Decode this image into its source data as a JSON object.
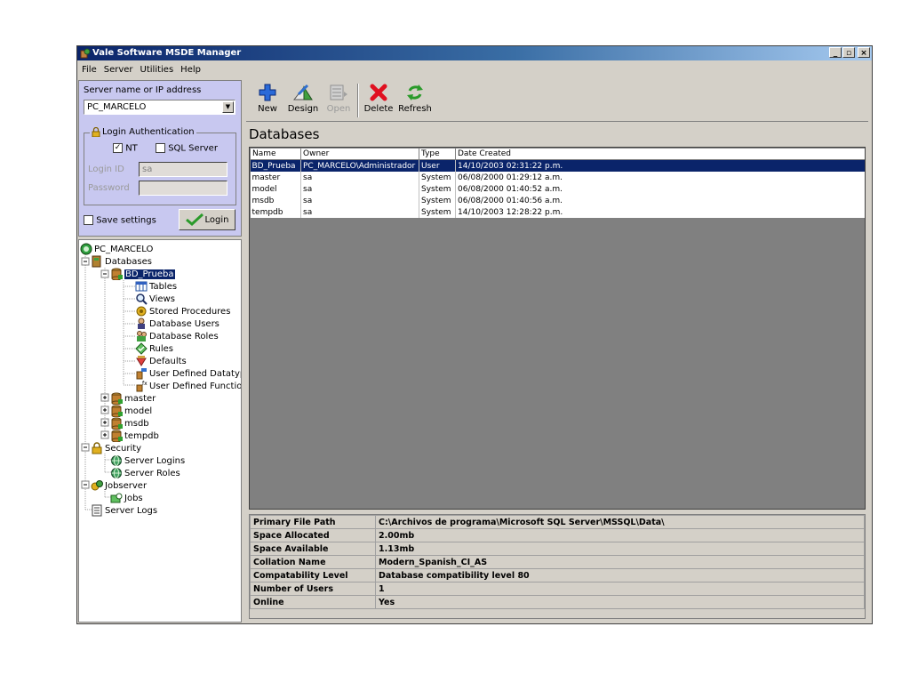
{
  "window": {
    "title": "Vale Software MSDE Manager",
    "buttons": [
      "_",
      "▫",
      "×"
    ]
  },
  "menu": [
    "File",
    "Server",
    "Utilities",
    "Help"
  ],
  "server_panel": {
    "server_label": "Server name or IP address",
    "server_value": "PC_MARCELO",
    "auth_group_label": "Login Authentication",
    "nt_label": "NT",
    "nt_checked": true,
    "sql_label": "SQL Server",
    "sql_checked": false,
    "login_id_label": "Login ID",
    "login_id_value": "sa",
    "password_label": "Password",
    "password_value": "",
    "save_settings_label": "Save settings",
    "login_button": "Login"
  },
  "tree": [
    {
      "label": "PC_MARCELO",
      "icon": "server-icon"
    },
    {
      "label": "Databases",
      "icon": "databases-icon"
    },
    {
      "label": "BD_Prueba",
      "icon": "database-icon",
      "selected": true
    },
    {
      "label": "Tables",
      "icon": "table-icon"
    },
    {
      "label": "Views",
      "icon": "view-icon"
    },
    {
      "label": "Stored Procedures",
      "icon": "stored-procedure-icon"
    },
    {
      "label": "Database Users",
      "icon": "user-icon"
    },
    {
      "label": "Database Roles",
      "icon": "roles-icon"
    },
    {
      "label": "Rules",
      "icon": "rules-icon"
    },
    {
      "label": "Defaults",
      "icon": "defaults-icon"
    },
    {
      "label": "User Defined Datatypes",
      "icon": "datatype-icon"
    },
    {
      "label": "User Defined Functions",
      "icon": "function-icon"
    },
    {
      "label": "master",
      "icon": "database-icon"
    },
    {
      "label": "model",
      "icon": "database-icon"
    },
    {
      "label": "msdb",
      "icon": "database-icon"
    },
    {
      "label": "tempdb",
      "icon": "database-icon"
    },
    {
      "label": "Security",
      "icon": "lock-icon"
    },
    {
      "label": "Server Logins",
      "icon": "globe-icon"
    },
    {
      "label": "Server Roles",
      "icon": "globe-icon"
    },
    {
      "label": "Jobserver",
      "icon": "jobserver-icon"
    },
    {
      "label": "Jobs",
      "icon": "jobs-icon"
    },
    {
      "label": "Server Logs",
      "icon": "log-icon"
    }
  ],
  "toolbar": {
    "new": "New",
    "design": "Design",
    "open": "Open",
    "delete": "Delete",
    "refresh": "Refresh"
  },
  "databases": {
    "heading": "Databases",
    "columns": [
      "Name",
      "Owner",
      "Type",
      "Date Created"
    ],
    "rows": [
      {
        "name": "BD_Prueba",
        "owner": "PC_MARCELO\\Administrador",
        "type": "User",
        "date": "14/10/2003 02:31:22 p.m.",
        "selected": true
      },
      {
        "name": "master",
        "owner": "sa",
        "type": "System",
        "date": "06/08/2000 01:29:12 a.m."
      },
      {
        "name": "model",
        "owner": "sa",
        "type": "System",
        "date": "06/08/2000 01:40:52 a.m."
      },
      {
        "name": "msdb",
        "owner": "sa",
        "type": "System",
        "date": "06/08/2000 01:40:56 a.m."
      },
      {
        "name": "tempdb",
        "owner": "sa",
        "type": "System",
        "date": "14/10/2003 12:28:22 p.m."
      }
    ]
  },
  "properties": [
    {
      "label": "Primary File Path",
      "value": "C:\\Archivos de programa\\Microsoft SQL Server\\MSSQL\\Data\\"
    },
    {
      "label": "Space Allocated",
      "value": "2.00mb"
    },
    {
      "label": "Space Available",
      "value": "1.13mb"
    },
    {
      "label": "Collation Name",
      "value": "Modern_Spanish_CI_AS"
    },
    {
      "label": "Compatability Level",
      "value": "Database compatibility level 80"
    },
    {
      "label": "Number of Users",
      "value": "1"
    },
    {
      "label": "Online",
      "value": "Yes"
    }
  ]
}
